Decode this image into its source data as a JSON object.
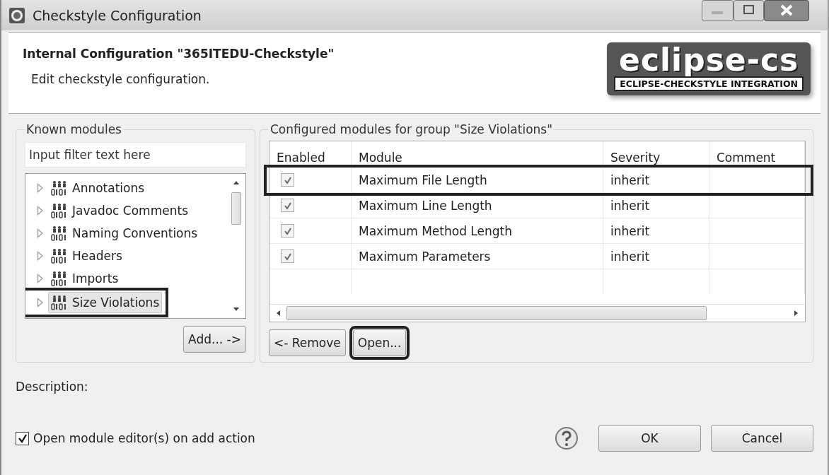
{
  "window": {
    "title": "Checkstyle Configuration"
  },
  "header": {
    "title": "Internal Configuration \"365ITEDU-Checkstyle\"",
    "subtitle": "Edit checkstyle configuration.",
    "logo": {
      "name": "eclipse-cs",
      "tagline": "ECLIPSE-CHECKSTYLE INTEGRATION"
    }
  },
  "known_modules": {
    "label": "Known modules",
    "filter": {
      "placeholder": "Input filter text here"
    },
    "items": [
      {
        "label": "Annotations",
        "selected": false,
        "highlighted": false
      },
      {
        "label": "Javadoc Comments",
        "selected": false,
        "highlighted": false
      },
      {
        "label": "Naming Conventions",
        "selected": false,
        "highlighted": false
      },
      {
        "label": "Headers",
        "selected": false,
        "highlighted": false
      },
      {
        "label": "Imports",
        "selected": false,
        "highlighted": false
      },
      {
        "label": "Size Violations",
        "selected": true,
        "highlighted": true
      }
    ],
    "add_button": "Add... ->"
  },
  "configured_modules": {
    "label": "Configured modules for group \"Size Violations\"",
    "columns": [
      "Enabled",
      "Module",
      "Severity",
      "Comment"
    ],
    "rows": [
      {
        "enabled": true,
        "module": "Maximum File Length",
        "severity": "inherit",
        "highlighted": true
      },
      {
        "enabled": true,
        "module": "Maximum Line Length",
        "severity": "inherit",
        "highlighted": false
      },
      {
        "enabled": true,
        "module": "Maximum Method Length",
        "severity": "inherit",
        "highlighted": false
      },
      {
        "enabled": true,
        "module": "Maximum Parameters",
        "severity": "inherit",
        "highlighted": false
      }
    ],
    "buttons": [
      {
        "label": "<- Remove",
        "highlighted": false
      },
      {
        "label": "Open...",
        "highlighted": true
      }
    ]
  },
  "description": {
    "label": "Description:"
  },
  "footer": {
    "open_editor": {
      "label": "Open module editor(s) on add action",
      "checked": true
    },
    "buttons": [
      "OK",
      "Cancel"
    ]
  }
}
